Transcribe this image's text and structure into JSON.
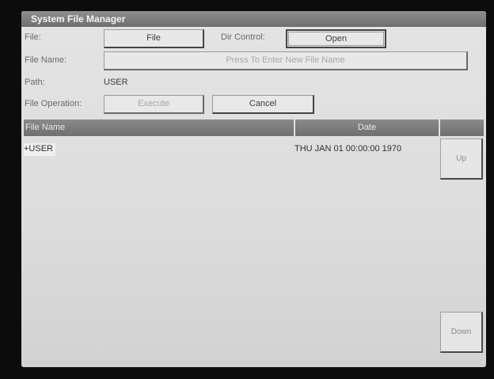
{
  "window": {
    "title": "System File Manager"
  },
  "form": {
    "file_label": "File:",
    "file_button": "File",
    "dir_control_label": "Dir Control:",
    "dir_control_button": "Open",
    "file_name_label": "File Name:",
    "file_name_placeholder": "Press To Enter New File Name",
    "path_label": "Path:",
    "path_value": "USER",
    "file_operation_label": "File Operation:",
    "execute_button": "Execute",
    "cancel_button": "Cancel"
  },
  "table": {
    "columns": [
      "File Name",
      "Date"
    ],
    "rows": [
      {
        "name": "+USER",
        "date": "THU JAN 01 00:00:00 1970"
      }
    ]
  },
  "nav": {
    "up": "Up",
    "down": "Down"
  }
}
